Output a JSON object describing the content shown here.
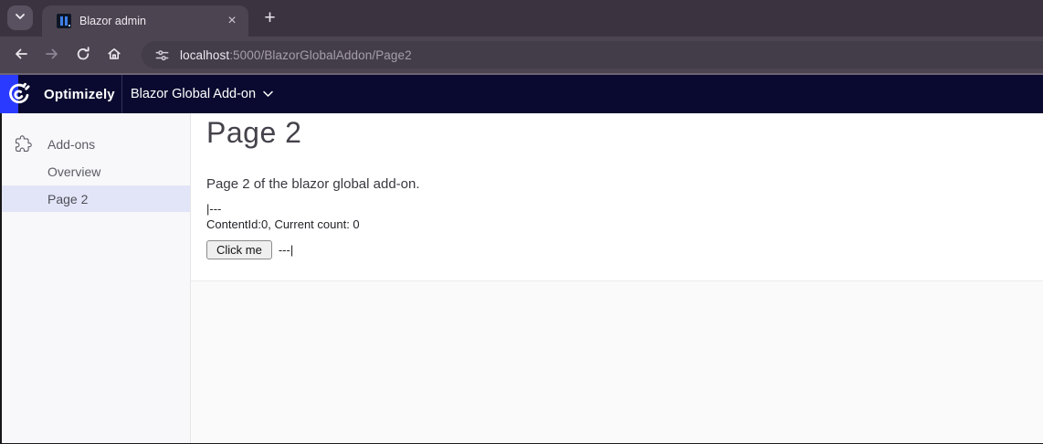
{
  "browser": {
    "tab_title": "Blazor admin",
    "close_tab_label": "×",
    "new_tab_label": "+",
    "url_host": "localhost",
    "url_rest": ":5000/BlazorGlobalAddon/Page2"
  },
  "header": {
    "brand": "Optimizely",
    "app_title": "Blazor Global Add-on"
  },
  "sidebar": {
    "items": [
      {
        "label": "Add-ons",
        "selected": false
      },
      {
        "label": "Overview",
        "selected": false
      },
      {
        "label": "Page 2",
        "selected": true
      }
    ]
  },
  "main": {
    "title": "Page 2",
    "description": "Page 2 of the blazor global add-on.",
    "marker_top": "|---",
    "status_line": "ContentId:0, Current count: 0",
    "button_label": "Click me",
    "marker_after_button": "---|"
  },
  "icons": {
    "tab_search": "chevron-down",
    "favicon": "blazor-admin-bars",
    "back": "arrow-left",
    "forward": "arrow-right",
    "reload": "refresh",
    "home": "house",
    "site_info": "tune-sliders",
    "brand_mark": "optimizely-mark",
    "add_ons": "puzzle",
    "app_switcher": "chevron-down"
  },
  "colors": {
    "chrome_tabstrip": "#3b3440",
    "chrome_toolbar": "#4c4450",
    "omnibox": "#433c49",
    "header_navy": "#0a0a30",
    "brand_blue": "#2a3bff",
    "sidebar_bg": "#f8f8fa",
    "selected_item_bg": "#e2e5f7",
    "content_footer_bg": "#fafafa"
  }
}
